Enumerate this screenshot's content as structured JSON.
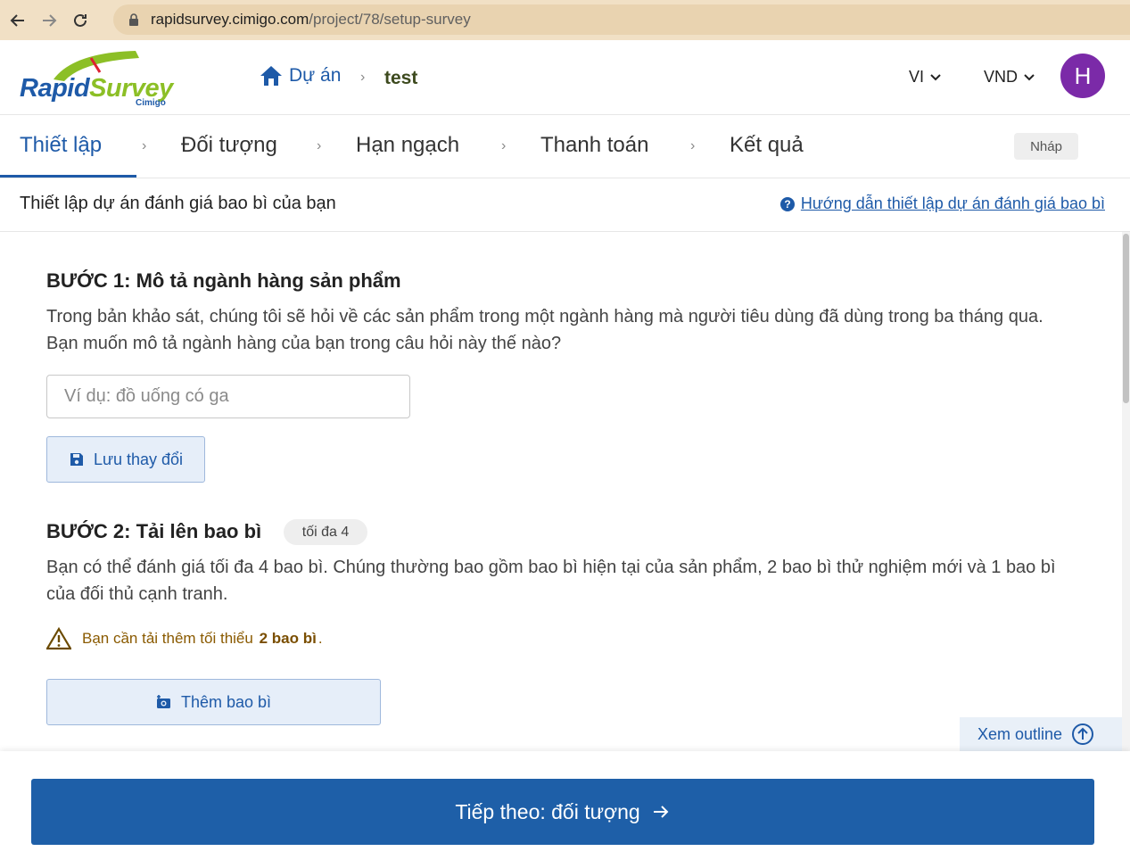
{
  "browser": {
    "url_host": "rapidsurvey.cimigo.com",
    "url_path": "/project/78/setup-survey"
  },
  "header": {
    "logo_rapid": "Rapid",
    "logo_survey": "Survey",
    "logo_sub": "Cimigo",
    "breadcrumb_home": "Dự án",
    "breadcrumb_sep": "›",
    "breadcrumb_current": "test",
    "language": "VI",
    "currency": "VND",
    "avatar_initial": "H"
  },
  "steps": {
    "items": [
      {
        "label": "Thiết lập",
        "active": true
      },
      {
        "label": "Đối tượng",
        "active": false
      },
      {
        "label": "Hạn ngạch",
        "active": false
      },
      {
        "label": "Thanh toán",
        "active": false
      },
      {
        "label": "Kết quả",
        "active": false
      }
    ],
    "chevron": "›",
    "status_badge": "Nháp"
  },
  "subheader": {
    "title": "Thiết lập dự án đánh giá bao bì của bạn",
    "guide_link": "Hướng dẫn thiết lập dự án đánh giá bao bì"
  },
  "step1": {
    "heading": "BƯỚC 1: Mô tả ngành hàng sản phẩm",
    "description": "Trong bản khảo sát, chúng tôi sẽ hỏi về các sản phẩm trong một ngành hàng mà người tiêu dùng đã dùng trong ba tháng qua. Bạn muốn mô tả ngành hàng của bạn trong câu hỏi này thế nào?",
    "input_value": "",
    "input_placeholder": "Ví dụ: đồ uống có ga",
    "save_button": "Lưu thay đổi"
  },
  "step2": {
    "heading": "BƯỚC 2: Tải lên bao bì",
    "limit_badge": "tối đa 4",
    "description": "Bạn có thể đánh giá tối đa 4 bao bì. Chúng thường bao gồm bao bì hiện tại của sản phẩm, 2 bao bì thử nghiệm mới và 1 bao bì của đối thủ cạnh tranh.",
    "warning_prefix": "Bạn cần tải thêm tối thiểu",
    "warning_bold": "2 bao bì",
    "warning_suffix": ".",
    "add_button": "Thêm bao bì"
  },
  "outline_button": "Xem outline",
  "footer": {
    "next_button": "Tiếp theo: đối tượng"
  },
  "colors": {
    "primary": "#1e5aa8",
    "brand_green": "#8cbf26",
    "avatar": "#7b2aa8",
    "warning": "#8a5a00"
  }
}
